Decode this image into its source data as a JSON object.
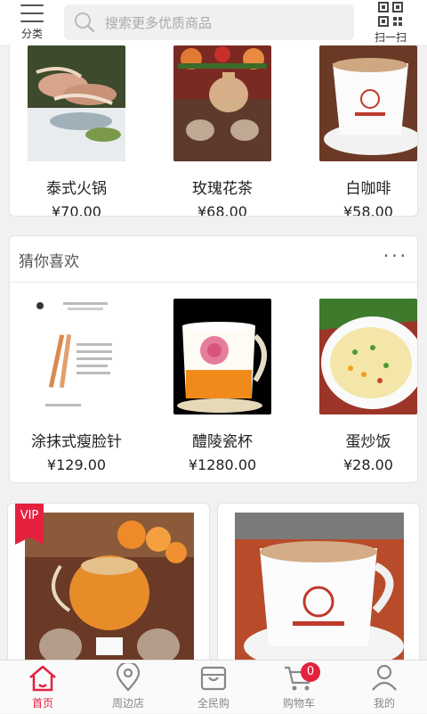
{
  "header": {
    "category_label": "分类",
    "search_placeholder": "搜索更多优质商品",
    "scan_label": "扫一扫"
  },
  "top_products": [
    {
      "name": "泰式火锅",
      "price": "¥70.00"
    },
    {
      "name": "玫瑰花茶",
      "price": "¥68.00"
    },
    {
      "name": "白咖啡",
      "price": "¥58.00"
    }
  ],
  "guess_section": {
    "title": "猜你喜欢",
    "more": "···",
    "items": [
      {
        "name": "涂抹式瘦脸针",
        "price": "¥129.00"
      },
      {
        "name": "醴陵瓷杯",
        "price": "¥1280.00"
      },
      {
        "name": "蛋炒饭",
        "price": "¥28.00"
      }
    ]
  },
  "featured": {
    "vip_label": "VIP"
  },
  "bottom_nav": {
    "items": [
      {
        "label": "首页"
      },
      {
        "label": "周边店"
      },
      {
        "label": "全民购"
      },
      {
        "label": "购物车"
      },
      {
        "label": "我的"
      }
    ],
    "cart_count": "0"
  },
  "colors": {
    "accent": "#e5213e",
    "inactive": "#888888"
  }
}
